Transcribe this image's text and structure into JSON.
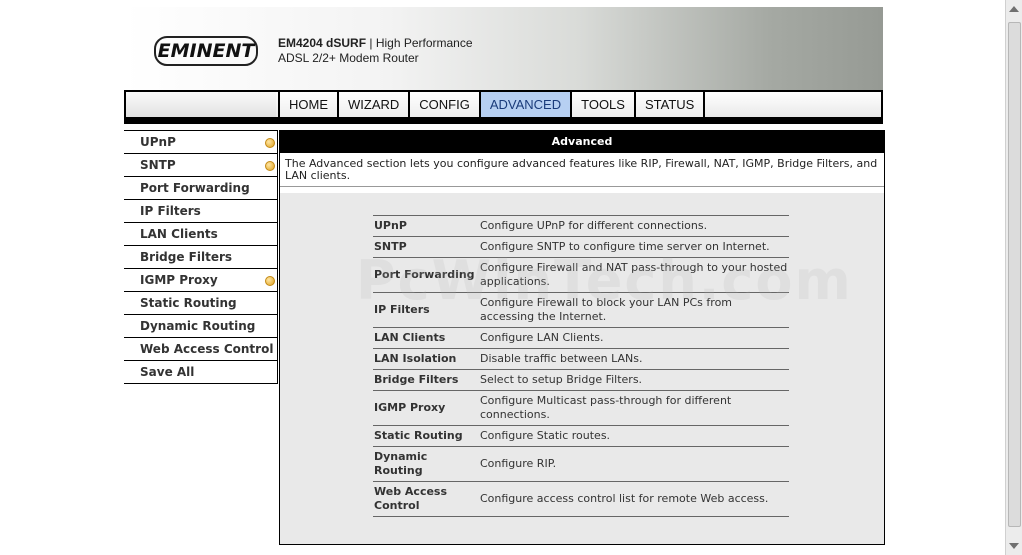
{
  "brand": {
    "logo_text": "EMINENT",
    "model": "EM4204 dSURF",
    "tagline": " | High Performance",
    "product_line2": "ADSL 2/2+ Modem Router"
  },
  "nav": {
    "tabs": [
      {
        "label": "HOME"
      },
      {
        "label": "WIZARD"
      },
      {
        "label": "CONFIG"
      },
      {
        "label": "ADVANCED"
      },
      {
        "label": "TOOLS"
      },
      {
        "label": "STATUS"
      }
    ],
    "active": "ADVANCED"
  },
  "sidebar": {
    "items": [
      {
        "label": "UPnP",
        "has_indicator": true
      },
      {
        "label": "SNTP",
        "has_indicator": true
      },
      {
        "label": "Port Forwarding",
        "has_indicator": false
      },
      {
        "label": "IP Filters",
        "has_indicator": false
      },
      {
        "label": "LAN Clients",
        "has_indicator": false
      },
      {
        "label": "Bridge Filters",
        "has_indicator": false
      },
      {
        "label": "IGMP Proxy",
        "has_indicator": true
      },
      {
        "label": "Static Routing",
        "has_indicator": false
      },
      {
        "label": "Dynamic Routing",
        "has_indicator": false
      },
      {
        "label": "Web Access Control",
        "has_indicator": false
      },
      {
        "label": "Save All",
        "has_indicator": false
      }
    ]
  },
  "main": {
    "title": "Advanced",
    "intro": "The Advanced section lets you configure advanced features like RIP, Firewall, NAT, IGMP, Bridge Filters, and LAN clients.",
    "features": [
      {
        "name": "UPnP",
        "desc": "Configure UPnP for different connections."
      },
      {
        "name": "SNTP",
        "desc": "Configure SNTP to configure time server on Internet."
      },
      {
        "name": "Port Forwarding",
        "desc": "Configure Firewall and NAT pass-through to your hosted applications."
      },
      {
        "name": "IP Filters",
        "desc": "Configure Firewall to block your LAN PCs from accessing the Internet."
      },
      {
        "name": "LAN Clients",
        "desc": "Configure LAN Clients."
      },
      {
        "name": "LAN Isolation",
        "desc": "Disable traffic between LANs."
      },
      {
        "name": "Bridge Filters",
        "desc": "Select to setup Bridge Filters."
      },
      {
        "name": "IGMP Proxy",
        "desc": "Configure Multicast pass-through for different connections."
      },
      {
        "name": "Static Routing",
        "desc": "Configure Static routes."
      },
      {
        "name": "Dynamic Routing",
        "desc": "Configure RIP."
      },
      {
        "name": "Web Access Control",
        "desc": "Configure access control list for remote Web access."
      }
    ]
  },
  "watermark": "PcWinTech.com",
  "colors": {
    "active_tab": "#b7d0f2",
    "header_bg": "#000000",
    "table_bg": "#e9e9e9",
    "indicator": "#e0a21e"
  }
}
